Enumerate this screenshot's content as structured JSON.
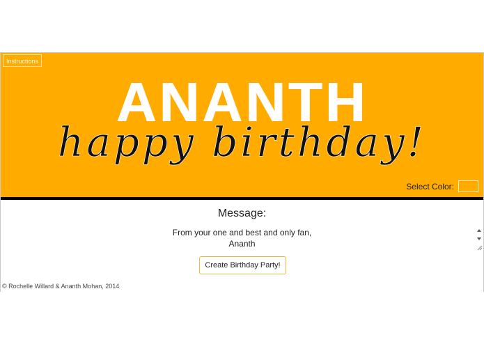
{
  "header": {
    "instructions_label": "Instructions",
    "name": "ANANTH",
    "greeting": "happy birthday!",
    "select_color_label": "Select Color:",
    "selected_color": "#ffab00"
  },
  "colors": {
    "banner": "#ffab00",
    "divider": "#000000",
    "button_border": "#f0b73f"
  },
  "message": {
    "label": "Message:",
    "text": "From your one and best and only fan,\nAnanth"
  },
  "actions": {
    "create_party_label": "Create Birthday Party!"
  },
  "footer": {
    "copyright": "© Rochelle Willard & Ananth Mohan, 2014"
  }
}
